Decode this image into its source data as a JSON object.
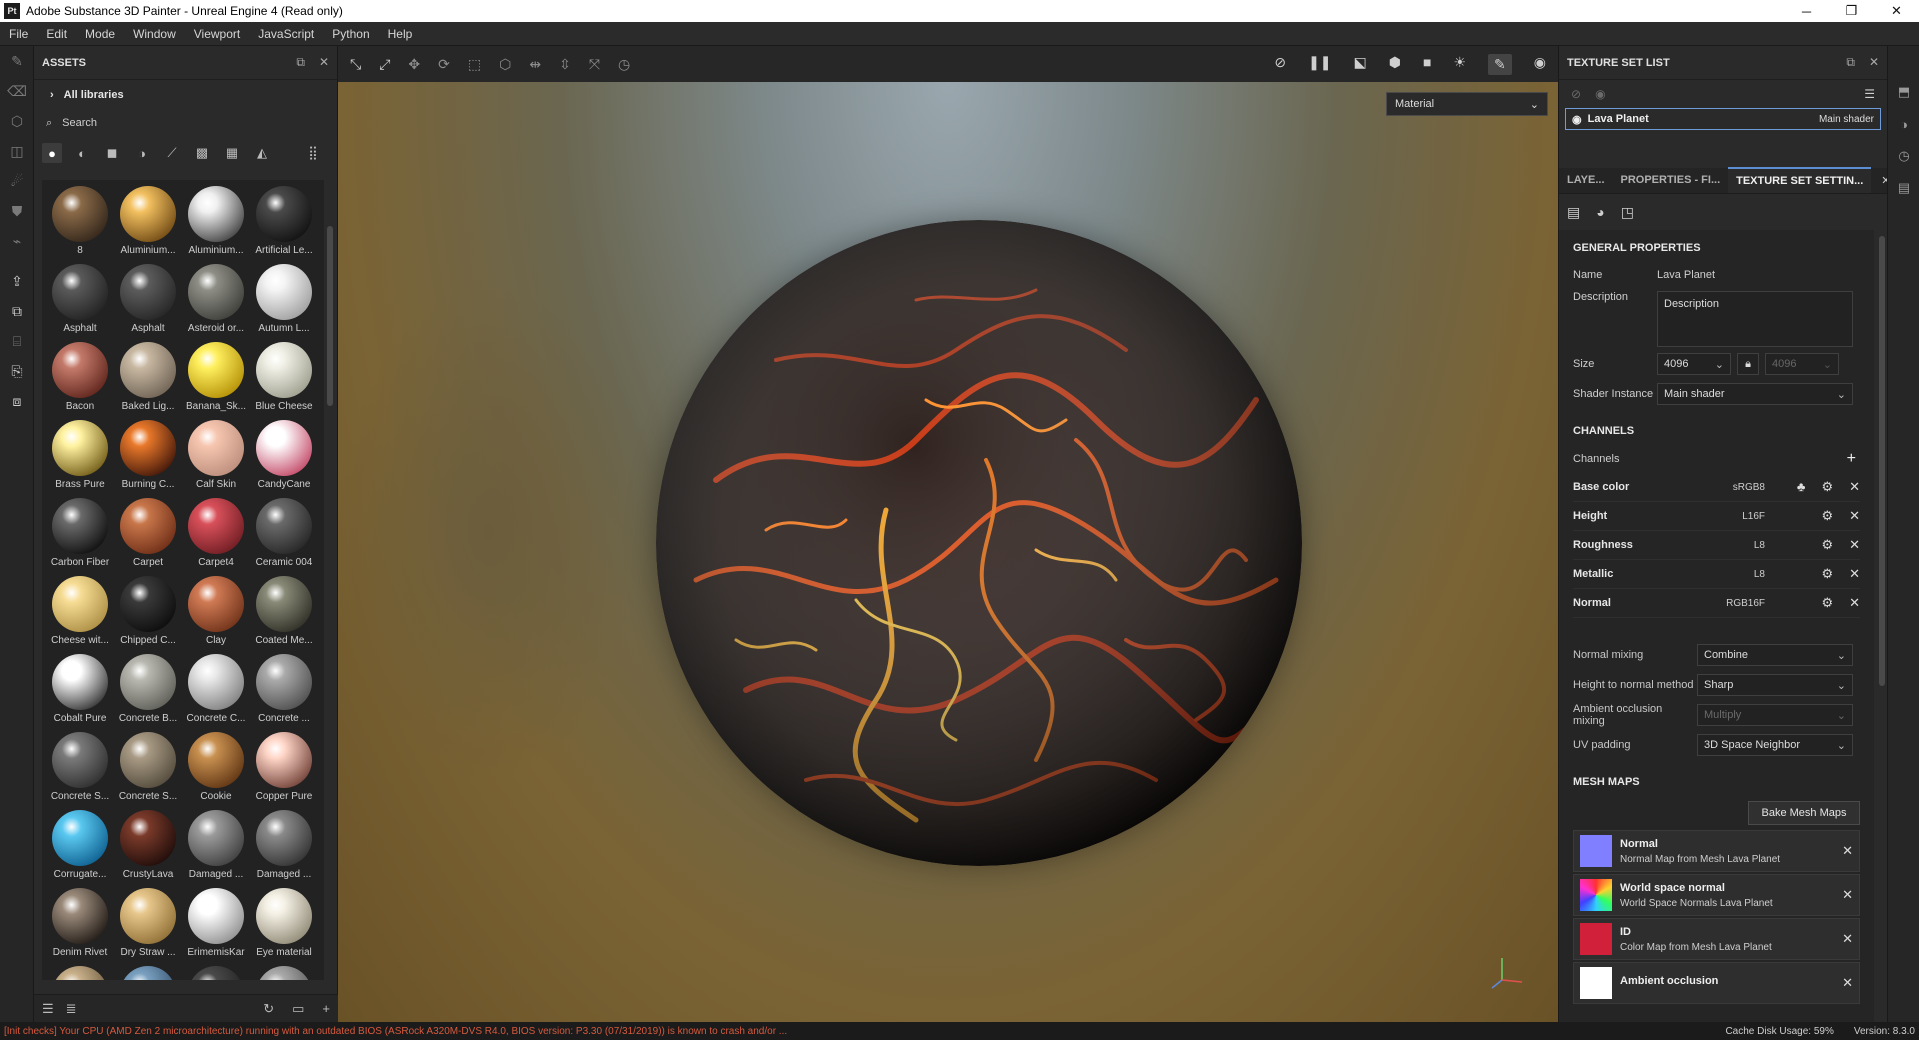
{
  "titlebar": {
    "app_icon": "Pt",
    "title": "Adobe Substance 3D Painter - Unreal Engine 4 (Read only)",
    "minimize": "─",
    "maximize": "❐",
    "close": "✕"
  },
  "menu": [
    "File",
    "Edit",
    "Mode",
    "Window",
    "Viewport",
    "JavaScript",
    "Python",
    "Help"
  ],
  "assets": {
    "title": "ASSETS",
    "all_libraries": "All libraries",
    "search_placeholder": "Search",
    "items": [
      {
        "label": "8",
        "c1": "#8a6a48",
        "c2": "#2e2218"
      },
      {
        "label": "Aluminium...",
        "c1": "#f2c060",
        "c2": "#6a4410"
      },
      {
        "label": "Aluminium...",
        "c1": "#f0f0f0",
        "c2": "#3a3a3a"
      },
      {
        "label": "Artificial Le...",
        "c1": "#4a4a4a",
        "c2": "#0e0e0e"
      },
      {
        "label": "Asphalt",
        "c1": "#5a5a5a",
        "c2": "#1e1e1e"
      },
      {
        "label": "Asphalt",
        "c1": "#5c5c5c",
        "c2": "#222222"
      },
      {
        "label": "Asteroid or...",
        "c1": "#8e8e86",
        "c2": "#3a3a36"
      },
      {
        "label": "Autumn L...",
        "c1": "#f4f4f4",
        "c2": "#9a9a9a"
      },
      {
        "label": "Bacon",
        "c1": "#c47a6a",
        "c2": "#5a2018"
      },
      {
        "label": "Baked Lig...",
        "c1": "#c8b8a2",
        "c2": "#6a5e50"
      },
      {
        "label": "Banana_Sk...",
        "c1": "#fff060",
        "c2": "#b08a00"
      },
      {
        "label": "Blue Cheese",
        "c1": "#f0f0e6",
        "c2": "#9a9a8a"
      },
      {
        "label": "Brass Pure",
        "c1": "#fff2a0",
        "c2": "#6a5410"
      },
      {
        "label": "Burning C...",
        "c1": "#e8782a",
        "c2": "#3a1208"
      },
      {
        "label": "Calf Skin",
        "c1": "#f6c6b0",
        "c2": "#b88a78"
      },
      {
        "label": "CandyCane",
        "c1": "#ffffff",
        "c2": "#c04060"
      },
      {
        "label": "Carbon Fiber",
        "c1": "#6a6a6a",
        "c2": "#0a0a0a"
      },
      {
        "label": "Carpet",
        "c1": "#c8764a",
        "c2": "#6a2a14"
      },
      {
        "label": "Carpet4",
        "c1": "#d8505a",
        "c2": "#6a1a20"
      },
      {
        "label": "Ceramic 004",
        "c1": "#6a6a6a",
        "c2": "#222"
      },
      {
        "label": "Cheese wit...",
        "c1": "#f6dc94",
        "c2": "#a88a40"
      },
      {
        "label": "Chipped C...",
        "c1": "#3a3a3a",
        "c2": "#0a0a0a"
      },
      {
        "label": "Clay",
        "c1": "#d07a54",
        "c2": "#6a2e16"
      },
      {
        "label": "Coated Me...",
        "c1": "#8a8a78",
        "c2": "#2a2a22"
      },
      {
        "label": "Cobalt Pure",
        "c1": "#ffffff",
        "c2": "#2a2a2a"
      },
      {
        "label": "Concrete B...",
        "c1": "#b8b8b0",
        "c2": "#5a5a54"
      },
      {
        "label": "Concrete C...",
        "c1": "#e8e8e8",
        "c2": "#7a7a7a"
      },
      {
        "label": "Concrete ...",
        "c1": "#aaaaaa",
        "c2": "#4a4a4a"
      },
      {
        "label": "Concrete S...",
        "c1": "#7a7a7a",
        "c2": "#2a2a2a"
      },
      {
        "label": "Concrete S...",
        "c1": "#a89a84",
        "c2": "#4e4638"
      },
      {
        "label": "Cookie",
        "c1": "#c89050",
        "c2": "#5a3010"
      },
      {
        "label": "Copper Pure",
        "c1": "#ffd6c8",
        "c2": "#6a3a30"
      },
      {
        "label": "Corrugate...",
        "c1": "#5ac8f0",
        "c2": "#0a5a8a"
      },
      {
        "label": "CrustyLava",
        "c1": "#7a3a2a",
        "c2": "#1a0a08"
      },
      {
        "label": "Damaged ...",
        "c1": "#9a9a9a",
        "c2": "#3a3a3a"
      },
      {
        "label": "Damaged ...",
        "c1": "#8a8a8a",
        "c2": "#2e2e2e"
      },
      {
        "label": "Denim Rivet",
        "c1": "#9a8a7a",
        "c2": "#1a1410"
      },
      {
        "label": "Dry Straw ...",
        "c1": "#e6c68a",
        "c2": "#8a6a30"
      },
      {
        "label": "ErimemisKar",
        "c1": "#ffffff",
        "c2": "#8a8a8a"
      },
      {
        "label": "Eye material",
        "c1": "#f4f0e4",
        "c2": "#8a8470"
      },
      {
        "label": "",
        "c1": "#c8b08a",
        "c2": "#5a4a30"
      },
      {
        "label": "",
        "c1": "#7aa0c0",
        "c2": "#2a4460"
      },
      {
        "label": "",
        "c1": "#4a4a4a",
        "c2": "#1a1a1a"
      },
      {
        "label": "",
        "c1": "#aaaaaa",
        "c2": "#4a4a4a"
      }
    ]
  },
  "viewport": {
    "material_select": "Material"
  },
  "texture_set_list": {
    "title": "TEXTURE SET LIST",
    "item_name": "Lava Planet",
    "item_shader": "Main shader"
  },
  "tabs": [
    "LAYE...",
    "PROPERTIES - FI...",
    "TEXTURE SET SETTIN..."
  ],
  "general": {
    "title": "GENERAL PROPERTIES",
    "name_label": "Name",
    "name_value": "Lava Planet",
    "description_label": "Description",
    "description_value": "Description",
    "size_label": "Size",
    "size_value": "4096",
    "size_linked": "4096",
    "shader_label": "Shader Instance",
    "shader_value": "Main shader"
  },
  "channels": {
    "title": "CHANNELS",
    "channels_label": "Channels",
    "add": "+",
    "list": [
      {
        "name": "Base color",
        "format": "sRGB8"
      },
      {
        "name": "Height",
        "format": "L16F"
      },
      {
        "name": "Roughness",
        "format": "L8"
      },
      {
        "name": "Metallic",
        "format": "L8"
      },
      {
        "name": "Normal",
        "format": "RGB16F"
      }
    ]
  },
  "mixing": [
    {
      "label": "Normal mixing",
      "value": "Combine",
      "disabled": false
    },
    {
      "label": "Height to normal method",
      "value": "Sharp",
      "disabled": false
    },
    {
      "label": "Ambient occlusion mixing",
      "value": "Multiply",
      "disabled": true
    },
    {
      "label": "UV padding",
      "value": "3D Space Neighbor",
      "disabled": false
    }
  ],
  "mesh_maps": {
    "title": "MESH MAPS",
    "bake_button": "Bake Mesh Maps",
    "list": [
      {
        "name": "Normal",
        "desc": "Normal Map from Mesh Lava Planet",
        "color": "#7f7fff"
      },
      {
        "name": "World space normal",
        "desc": "World Space Normals Lava Planet",
        "color": "rainbow"
      },
      {
        "name": "ID",
        "desc": "Color Map from Mesh Lava Planet",
        "color": "#d0203a"
      },
      {
        "name": "Ambient occlusion",
        "desc": "",
        "color": "#ffffff"
      }
    ]
  },
  "status": {
    "error": "[Init checks] Your CPU (AMD Zen 2 microarchitecture) running with an outdated BIOS (ASRock A320M-DVS R4.0, BIOS version: P3.30 (07/31/2019)) is known to crash and/or ...",
    "cache": "Cache Disk Usage:",
    "cache_value": "59%",
    "version": "Version: 8.3.0"
  }
}
